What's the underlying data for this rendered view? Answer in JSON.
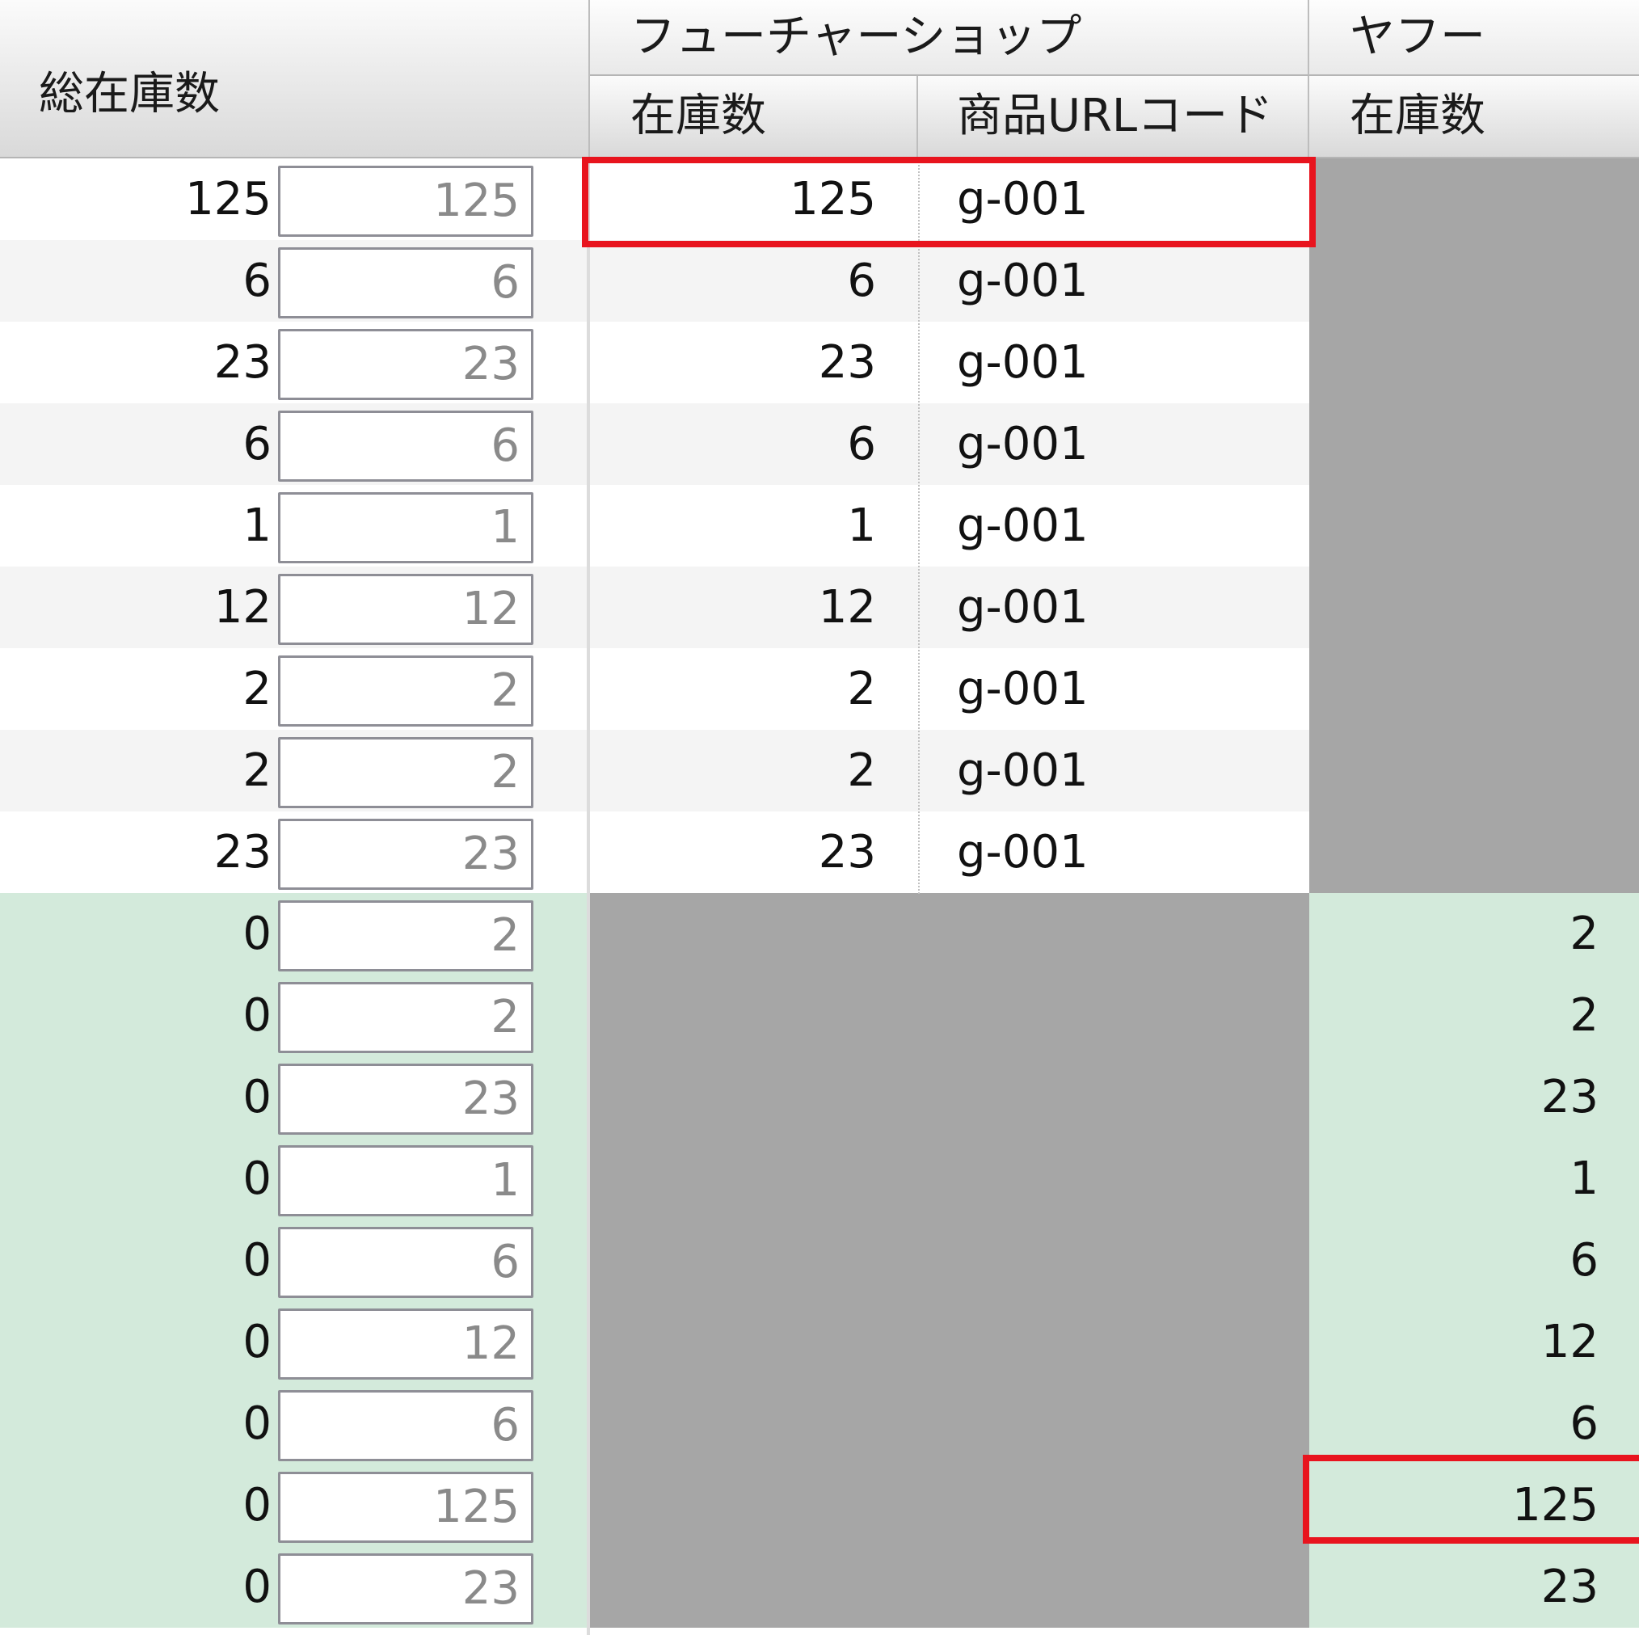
{
  "header": {
    "total_stock": "総在庫数",
    "future_shop": "フューチャーショップ",
    "future_shop_stock": "在庫数",
    "future_shop_url_code": "商品URLコード",
    "yahoo": "ヤフー",
    "yahoo_stock": "在庫数"
  },
  "rows": [
    {
      "total": "125",
      "edit": "125",
      "fs_stock": "125",
      "fs_code": "g-001",
      "yahoo_stock": ""
    },
    {
      "total": "6",
      "edit": "6",
      "fs_stock": "6",
      "fs_code": "g-001",
      "yahoo_stock": ""
    },
    {
      "total": "23",
      "edit": "23",
      "fs_stock": "23",
      "fs_code": "g-001",
      "yahoo_stock": ""
    },
    {
      "total": "6",
      "edit": "6",
      "fs_stock": "6",
      "fs_code": "g-001",
      "yahoo_stock": ""
    },
    {
      "total": "1",
      "edit": "1",
      "fs_stock": "1",
      "fs_code": "g-001",
      "yahoo_stock": ""
    },
    {
      "total": "12",
      "edit": "12",
      "fs_stock": "12",
      "fs_code": "g-001",
      "yahoo_stock": ""
    },
    {
      "total": "2",
      "edit": "2",
      "fs_stock": "2",
      "fs_code": "g-001",
      "yahoo_stock": ""
    },
    {
      "total": "2",
      "edit": "2",
      "fs_stock": "2",
      "fs_code": "g-001",
      "yahoo_stock": ""
    },
    {
      "total": "23",
      "edit": "23",
      "fs_stock": "23",
      "fs_code": "g-001",
      "yahoo_stock": ""
    },
    {
      "total": "0",
      "edit": "2",
      "fs_stock": "",
      "fs_code": "",
      "yahoo_stock": "2"
    },
    {
      "total": "0",
      "edit": "2",
      "fs_stock": "",
      "fs_code": "",
      "yahoo_stock": "2"
    },
    {
      "total": "0",
      "edit": "23",
      "fs_stock": "",
      "fs_code": "",
      "yahoo_stock": "23"
    },
    {
      "total": "0",
      "edit": "1",
      "fs_stock": "",
      "fs_code": "",
      "yahoo_stock": "1"
    },
    {
      "total": "0",
      "edit": "6",
      "fs_stock": "",
      "fs_code": "",
      "yahoo_stock": "6"
    },
    {
      "total": "0",
      "edit": "12",
      "fs_stock": "",
      "fs_code": "",
      "yahoo_stock": "12"
    },
    {
      "total": "0",
      "edit": "6",
      "fs_stock": "",
      "fs_code": "",
      "yahoo_stock": "6"
    },
    {
      "total": "0",
      "edit": "125",
      "fs_stock": "",
      "fs_code": "",
      "yahoo_stock": "125"
    },
    {
      "total": "0",
      "edit": "23",
      "fs_stock": "",
      "fs_code": "",
      "yahoo_stock": "23"
    }
  ],
  "colors": {
    "row_alt": "#f4f4f4",
    "matched_row": "#d3eadb",
    "disabled_cell": "#a6a6a6",
    "highlight": "#e8141e"
  }
}
